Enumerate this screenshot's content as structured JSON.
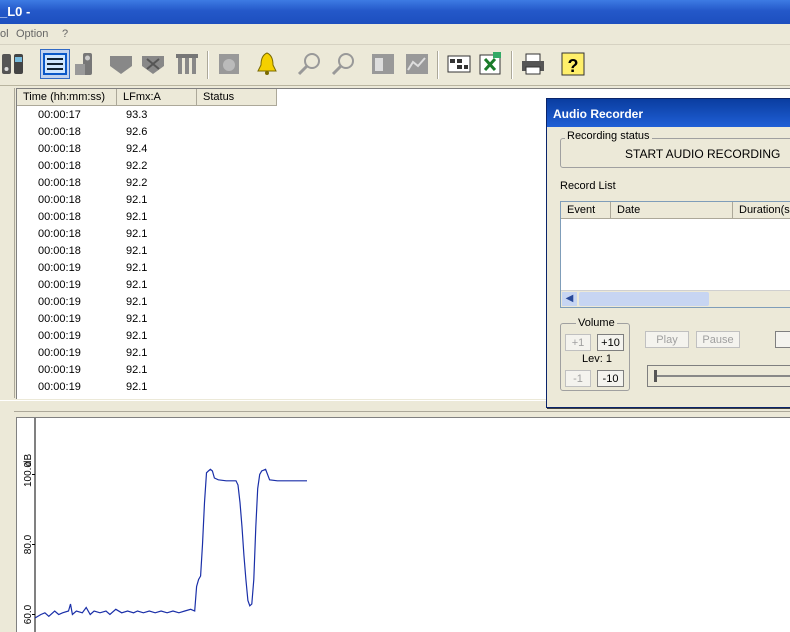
{
  "window": {
    "title": "_L0 -"
  },
  "menu": {
    "items": [
      "ol",
      "Option",
      "?"
    ]
  },
  "table": {
    "columns": [
      "Time (hh:mm:ss)",
      "LFmx:A",
      "Status"
    ],
    "rows": [
      {
        "time": "00:00:17",
        "value": "93.3"
      },
      {
        "time": "00:00:18",
        "value": "92.6"
      },
      {
        "time": "00:00:18",
        "value": "92.4"
      },
      {
        "time": "00:00:18",
        "value": "92.2"
      },
      {
        "time": "00:00:18",
        "value": "92.2"
      },
      {
        "time": "00:00:18",
        "value": "92.1"
      },
      {
        "time": "00:00:18",
        "value": "92.1"
      },
      {
        "time": "00:00:18",
        "value": "92.1"
      },
      {
        "time": "00:00:18",
        "value": "92.1"
      },
      {
        "time": "00:00:19",
        "value": "92.1"
      },
      {
        "time": "00:00:19",
        "value": "92.1"
      },
      {
        "time": "00:00:19",
        "value": "92.1"
      },
      {
        "time": "00:00:19",
        "value": "92.1"
      },
      {
        "time": "00:00:19",
        "value": "92.1"
      },
      {
        "time": "00:00:19",
        "value": "92.1"
      },
      {
        "time": "00:00:19",
        "value": "92.1"
      },
      {
        "time": "00:00:19",
        "value": "92.1"
      }
    ]
  },
  "audio_recorder": {
    "title": "Audio Recorder",
    "recording_status_label": "Recording status",
    "recording_status_text": "START AUDIO RECORDING",
    "record_list_label": "Record List",
    "record_list_columns": [
      "Event",
      "Date",
      "Duration(se"
    ],
    "volume_label": "Volume",
    "vol_plus1": "+1",
    "vol_plus10": "+10",
    "level_text": "Lev: 1",
    "vol_minus1": "-1",
    "vol_minus10": "-10",
    "play_label": "Play",
    "pause_label": "Pause"
  },
  "chart_data": {
    "type": "line",
    "ylabel": "dB",
    "y_tick_labels": [
      "60.0",
      "80.0",
      "100.0"
    ],
    "ylim": [
      55,
      115
    ],
    "series": [
      {
        "color": "#1a2fa8",
        "points": [
          [
            0,
            59
          ],
          [
            3,
            60
          ],
          [
            5,
            60.5
          ],
          [
            7,
            59.5
          ],
          [
            10,
            61
          ],
          [
            12,
            60
          ],
          [
            14,
            60.5
          ],
          [
            17,
            61
          ],
          [
            18,
            63
          ],
          [
            19,
            60
          ],
          [
            21,
            61
          ],
          [
            24,
            60.5
          ],
          [
            26,
            62
          ],
          [
            28,
            60
          ],
          [
            30,
            61
          ],
          [
            33,
            60.5
          ],
          [
            36,
            61
          ],
          [
            38,
            60
          ],
          [
            41,
            61.5
          ],
          [
            44,
            60.5
          ],
          [
            47,
            61
          ],
          [
            50,
            60.5
          ],
          [
            52,
            61
          ],
          [
            55,
            60.5
          ],
          [
            58,
            61
          ],
          [
            61,
            60.5
          ],
          [
            64,
            61
          ],
          [
            67,
            60.5
          ],
          [
            70,
            61
          ],
          [
            73,
            60.5
          ],
          [
            76,
            61
          ],
          [
            79,
            61.5
          ],
          [
            81,
            61
          ],
          [
            82,
            68
          ],
          [
            83,
            70
          ],
          [
            84,
            71
          ],
          [
            85,
            80
          ],
          [
            86,
            92
          ],
          [
            87,
            100.5
          ],
          [
            88,
            101
          ],
          [
            89,
            101.5
          ],
          [
            90,
            101
          ],
          [
            91,
            99
          ],
          [
            93,
            98.5
          ],
          [
            97,
            98.2
          ],
          [
            102,
            98.2
          ],
          [
            103,
            97
          ],
          [
            104,
            92
          ],
          [
            105,
            85
          ],
          [
            106,
            77
          ],
          [
            107,
            70
          ],
          [
            108,
            64
          ],
          [
            109,
            62.5
          ],
          [
            110,
            63
          ],
          [
            111,
            70
          ],
          [
            112,
            85
          ],
          [
            113,
            96
          ],
          [
            114,
            100
          ],
          [
            115,
            101
          ],
          [
            117,
            101.5
          ],
          [
            119,
            98.5
          ],
          [
            123,
            98.2
          ],
          [
            128,
            98.2
          ],
          [
            131,
            98.2
          ],
          [
            134,
            98.2
          ],
          [
            138,
            98.2
          ]
        ]
      }
    ],
    "xlim": [
      0,
      138
    ],
    "grid": false
  }
}
